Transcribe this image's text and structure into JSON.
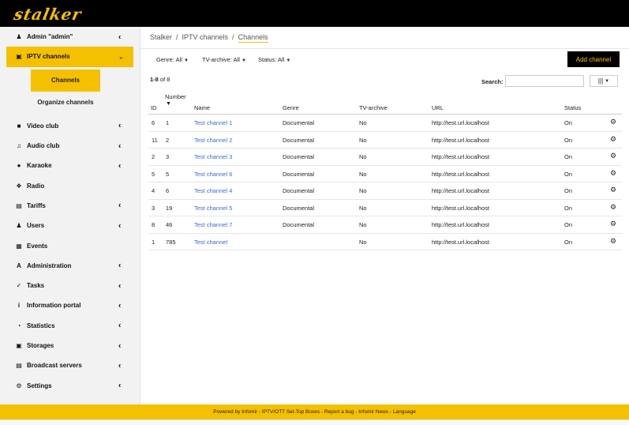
{
  "app": {
    "logo_text": "stalker",
    "accent_color": "#f5c000"
  },
  "sidebar": {
    "items": [
      {
        "label": "Admin \"admin\"",
        "icon": "user-icon",
        "has_chevron": true
      },
      {
        "label": "IPTV channels",
        "icon": "monitor-icon",
        "has_chevron": true,
        "active": true
      },
      {
        "label": "Video club",
        "icon": "video-camera-icon",
        "has_chevron": true
      },
      {
        "label": "Audio club",
        "icon": "music-note-icon",
        "has_chevron": true
      },
      {
        "label": "Karaoke",
        "icon": "microphone-icon",
        "has_chevron": true
      },
      {
        "label": "Radio",
        "icon": "radio-icon",
        "has_chevron": false
      },
      {
        "label": "Tariffs",
        "icon": "list-icon",
        "has_chevron": true
      },
      {
        "label": "Users",
        "icon": "users-icon",
        "has_chevron": true
      },
      {
        "label": "Events",
        "icon": "calendar-icon",
        "has_chevron": false
      },
      {
        "label": "Administration",
        "icon": "font-icon",
        "has_chevron": true
      },
      {
        "label": "Tasks",
        "icon": "check-icon",
        "has_chevron": true
      },
      {
        "label": "Information portal",
        "icon": "info-icon",
        "has_chevron": true
      },
      {
        "label": "Statistics",
        "icon": "pie-chart-icon",
        "has_chevron": true
      },
      {
        "label": "Storages",
        "icon": "storage-icon",
        "has_chevron": true
      },
      {
        "label": "Broadcast servers",
        "icon": "server-icon",
        "has_chevron": true
      },
      {
        "label": "Settings",
        "icon": "gears-icon",
        "has_chevron": true
      }
    ],
    "sub_items": [
      {
        "label": "Channels",
        "active": true
      },
      {
        "label": "Organize channels",
        "active": false
      }
    ]
  },
  "breadcrumb": {
    "items": [
      "Stalker",
      "IPTV channels",
      "Channels"
    ],
    "separator": "/"
  },
  "filters": {
    "genre": "Genre: All",
    "archive": "TV-archive: All",
    "status": "Status: All"
  },
  "add_button": "Add channel",
  "range": {
    "prefix": "1-8",
    "suffix": "of 8"
  },
  "search": {
    "label": "Search:",
    "value": ""
  },
  "columns_button": "|||",
  "table": {
    "headers": {
      "id": "ID",
      "number": "Number",
      "name": "Name",
      "genre": "Genre",
      "archive": "TV-archive",
      "url": "URL",
      "status": "Status"
    },
    "rows": [
      {
        "id": "6",
        "number": "1",
        "name": "Test channel 1",
        "genre": "Documental",
        "archive": "No",
        "url": "http://test.url.localhost",
        "status": "On"
      },
      {
        "id": "11",
        "number": "2",
        "name": "Test channel 2",
        "genre": "Documental",
        "archive": "No",
        "url": "http://test.url.localhost",
        "status": "On"
      },
      {
        "id": "2",
        "number": "3",
        "name": "Test channel 3",
        "genre": "Documental",
        "archive": "No",
        "url": "http://test.url.localhost",
        "status": "On"
      },
      {
        "id": "5",
        "number": "5",
        "name": "Test channel 6",
        "genre": "Documental",
        "archive": "No",
        "url": "http://test.url.localhost",
        "status": "On"
      },
      {
        "id": "4",
        "number": "6",
        "name": "Test channel 4",
        "genre": "Documental",
        "archive": "No",
        "url": "http://test.url.localhost",
        "status": "On"
      },
      {
        "id": "3",
        "number": "19",
        "name": "Test channel 5",
        "genre": "Documental",
        "archive": "No",
        "url": "http://test.url.localhost",
        "status": "On"
      },
      {
        "id": "8",
        "number": "46",
        "name": "Test channel 7",
        "genre": "Documental",
        "archive": "No",
        "url": "http://test.url.localhost",
        "status": "On"
      },
      {
        "id": "1",
        "number": "785",
        "name": "Test channel",
        "genre": "",
        "archive": "No",
        "url": "http://test.url.localhost",
        "status": "On"
      }
    ]
  },
  "footer": "Powered by Infomir - IPTV/OTT Set-Top Boxes - Report a bug - Infomir News - Language"
}
